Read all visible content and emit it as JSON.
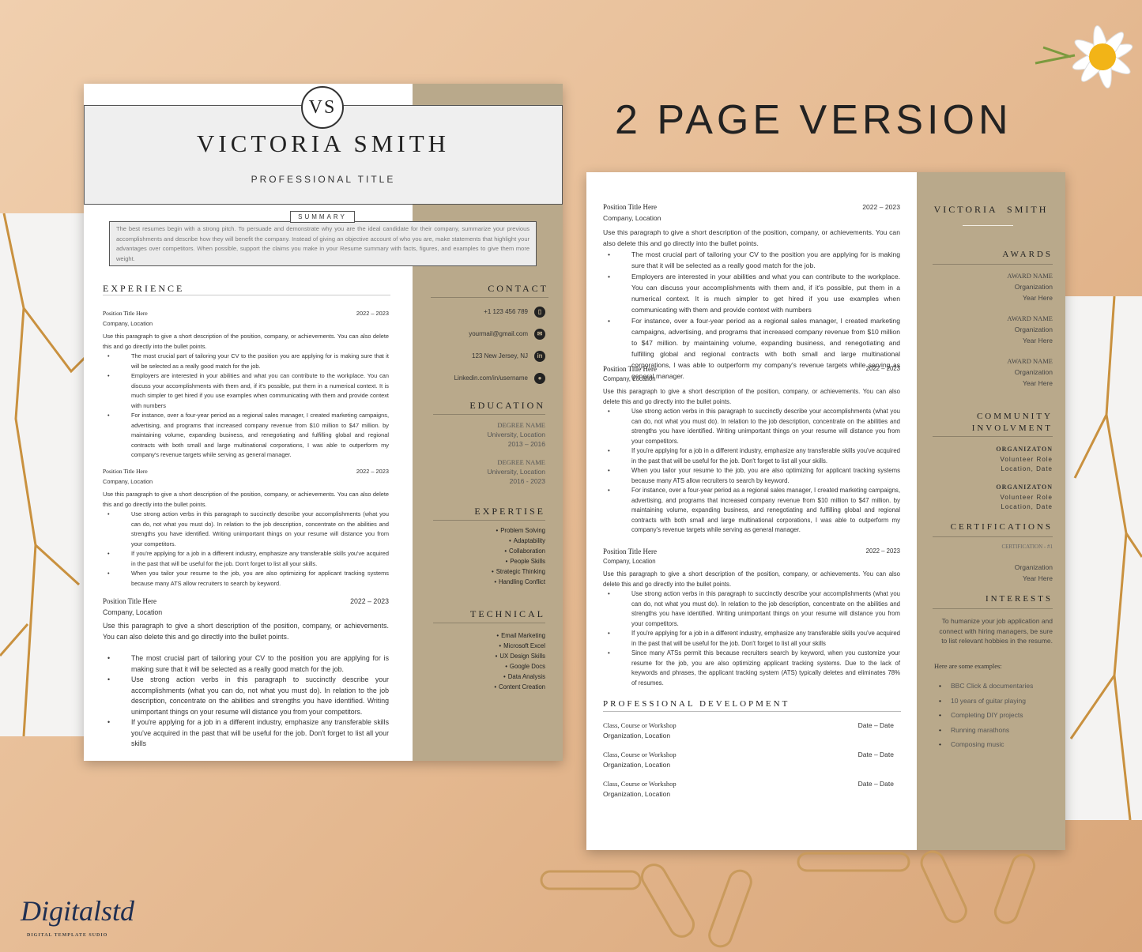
{
  "headline": "2 PAGE VERSION",
  "brand": {
    "logo_text": "Digitalstd",
    "tagline": "DIGITAL TEMPLATE SUDIO"
  },
  "colors": {
    "sidebar": "#b9a98b",
    "background": "#e7bd96",
    "header": "#efefef"
  },
  "page1": {
    "monogram": "VS",
    "name": "VICTORIA SMITH",
    "title": "PROFESSIONAL TITLE",
    "summary_label": "SUMMARY",
    "summary": "The best resumes begin with a strong pitch. To persuade and demonstrate why you are the ideal candidate for their company, summarize your previous accomplishments and describe how they will benefit the company. Instead of giving an objective account of who you are, make statements that highlight your advantages over competitors. When possible, support the claims you make in your Resume summary with facts, figures, and examples to give them more weight.",
    "experience_heading": "EXPERIENCE",
    "jobs": [
      {
        "title": "Position Title Here",
        "date": "2022 – 2023",
        "company": "Company, Location",
        "desc": "Use this paragraph to give a short description of the position, company, or achievements. You can also delete this and go directly into the bullet points.",
        "bullets": [
          "The most crucial part of tailoring your CV to the position you are applying for is making sure that it will be selected as a really good match for the job.",
          "Employers are interested in your abilities and what you can contribute to the workplace. You can discuss your accomplishments with them and, if it's possible, put them in a numerical context. It is much simpler to get hired if you use examples when communicating with them and provide context with numbers",
          "For instance, over a four-year period as a regional sales manager, I created marketing campaigns, advertising, and programs that increased company revenue from $10 million to $47 million. by maintaining volume, expanding business, and renegotiating and fulfilling global and regional contracts with both small and large multinational corporations, I was able to outperform my company's revenue targets while serving as general manager."
        ]
      },
      {
        "title": "Position Title Here",
        "date": "2022 – 2023",
        "company": "Company, Location",
        "desc": "Use this paragraph to give a short description of the position, company, or achievements. You can also delete this and go directly into the bullet points.",
        "bullets": [
          "Use strong action verbs in this paragraph to succinctly describe your accomplishments (what you can do, not what you must do). In relation to the job description, concentrate on the abilities and strengths you have identified. Writing unimportant things on your resume will distance you from your competitors.",
          "If you're applying for a job in a different industry, emphasize any transferable skills you've acquired in the past that will be useful for the job. Don't forget to list all your skills.",
          "When you tailor your resume to the job, you are also optimizing for applicant tracking systems because many ATS allow recruiters to search by keyword."
        ]
      },
      {
        "title": "Position Title Here",
        "date": "2022 – 2023",
        "company": "Company, Location",
        "desc": "Use this paragraph to give a short description of the position, company, or achievements. You can also delete this and go directly into the bullet points.",
        "bullets": [
          "The most crucial part of tailoring your CV to the position you are applying for is making sure that it will be selected as a really good match for the job.",
          "Use strong action verbs in this paragraph to succinctly describe your accomplishments (what you can do, not what you must do). In relation to the job description, concentrate on the abilities and strengths you have identified. Writing unimportant things on your resume will distance you from your competitors.",
          "If you're applying for a job in a different industry, emphasize any transferable skills you've acquired in the past that will be useful for the job. Don't forget to list all your skills"
        ]
      }
    ],
    "contact_heading": "CONTACT",
    "contact": [
      {
        "text": "+1 123 456 789",
        "icon": "phone-icon",
        "glyph": "▯"
      },
      {
        "text": "yourmail@gmail.com",
        "icon": "mail-icon",
        "glyph": "✉"
      },
      {
        "text": "123 New Jersey, NJ",
        "icon": "linkedin-icon",
        "glyph": "in"
      },
      {
        "text": "Linkedin.com/in/username",
        "icon": "location-pin-icon",
        "glyph": "●"
      }
    ],
    "education_heading": "EDUCATION",
    "education": [
      {
        "degree": "DEGREE NAME",
        "school": "University, Location",
        "years": "2013 – 2016"
      },
      {
        "degree": "DEGREE NAME",
        "school": "University, Location",
        "years": "2016 - 2023"
      }
    ],
    "expertise_heading": "EXPERTISE",
    "expertise": [
      "Problem Solving",
      "Adaptability",
      "Collaboration",
      "People Skills",
      "Strategic Thinking",
      "Handling Conflict"
    ],
    "technical_heading": "TECHNICAL",
    "technical": [
      "Email Marketing",
      "Microsoft Excel",
      "UX Design Skills",
      "Google Docs",
      "Data Analysis",
      "Content Creation"
    ]
  },
  "page2": {
    "name": "VICTORIA  SMITH",
    "jobs": [
      {
        "title": "Position Title Here",
        "date": "2022 – 2023",
        "company": "Company, Location",
        "desc": "Use this paragraph to give a short description of the position, company, or achievements. You can also delete this and go directly into the bullet points.",
        "bullets": [
          "The most crucial part of tailoring your CV to the position you are applying for is making sure that it will be selected as a really good match for the job.",
          "Employers are interested in your abilities and what you can contribute to the workplace. You can discuss your accomplishments with them and, if it's possible, put them in a numerical context. It is much simpler to get hired if you use examples when communicating with them and provide context with numbers",
          "For instance, over a four-year period as a regional sales manager, I created marketing campaigns, advertising, and programs that increased company revenue from $10 million to $47 million. by maintaining volume, expanding business, and renegotiating and fulfilling global and regional contracts with both small and large multinational corporations, I was able to outperform my company's revenue targets while serving as general manager."
        ]
      },
      {
        "title": "Position Title Here",
        "date": "2022 – 2023",
        "company": "Company, Location",
        "desc": "Use this paragraph to give a short description of the position, company, or achievements. You can also delete this and go directly into the bullet points.",
        "bullets": [
          "Use strong action verbs in this paragraph to succinctly describe your accomplishments (what you can do, not what you must do). In relation to the job description, concentrate on the abilities and strengths you have identified. Writing unimportant things on your resume will distance you from your competitors.",
          "If you're applying for a job in a different industry, emphasize any transferable skills you've acquired in the past that will be useful for the job. Don't forget to list all your skills.",
          "When you tailor your resume to the job, you are also optimizing for applicant tracking systems because many ATS allow recruiters to search by keyword.",
          "For instance, over a four-year period as a regional sales manager, I created marketing campaigns, advertising, and programs that increased company revenue from $10 million to $47 million. by maintaining volume, expanding business, and renegotiating and fulfilling global and regional contracts with both small and large multinational corporations, I was able to outperform my company's revenue targets while serving as general manager."
        ]
      },
      {
        "title": "Position Title Here",
        "date": "2022 – 2023",
        "company": "Company, Location",
        "desc": "Use this paragraph to give a short description of the position, company, or achievements. You can also delete this and go directly into the bullet points.",
        "bullets": [
          "Use strong action verbs in this paragraph to succinctly describe your accomplishments (what you can do, not what you must do). In relation to the job description, concentrate on the abilities and strengths you have identified. Writing unimportant things on your resume will distance you from your competitors.",
          "If you're applying for a job in a different industry, emphasize any transferable skills you've acquired in the past that will be useful for the job. Don't forget to list all your skills",
          "Since many ATSs permit this because recruiters search by keyword, when you customize your resume for the job, you are also optimizing applicant tracking systems. Due to the lack of keywords and phrases, the applicant tracking system (ATS) typically deletes and eliminates 78% of resumes."
        ]
      }
    ],
    "prof_dev_heading": "PROFESSIONAL DEVELOPMENT",
    "prof_dev": [
      {
        "course": "Class, Course or Workshop",
        "org": "Organization, Location",
        "date": "Date – Date"
      },
      {
        "course": "Class, Course or Workshop",
        "org": "Organization, Location",
        "date": "Date – Date"
      },
      {
        "course": "Class, Course or Workshop",
        "org": "Organization, Location",
        "date": "Date – Date"
      }
    ],
    "awards_heading": "AWARDS",
    "awards": [
      {
        "name": "AWARD NAME",
        "org": "Organization",
        "year": "Year Here"
      },
      {
        "name": "AWARD NAME",
        "org": "Organization",
        "year": "Year Here"
      },
      {
        "name": "AWARD NAME",
        "org": "Organization",
        "year": "Year Here"
      }
    ],
    "community_heading_1": "COMMUNITY",
    "community_heading_2": "INVOLVMENT",
    "community": [
      {
        "org": "ORGANIZATON",
        "role": "Volunteer Role",
        "loc": "Location, Date"
      },
      {
        "org": "ORGANIZATON",
        "role": "Volunteer Role",
        "loc": "Location, Date"
      }
    ],
    "cert_heading": "CERTIFICATIONS",
    "cert": {
      "name": "CERTIFICATION - #1",
      "org": "Organization",
      "year": "Year Here"
    },
    "interests_heading": "INTERESTS",
    "interests_intro": "To humanize your job application and connect with hiring managers, be sure to list relevant hobbies in the resume.",
    "interests_lead": "Here are some examples:",
    "interests": [
      "BBC Click & documentaries",
      "10 years of guitar playing",
      "Completing DIY projects",
      "Running marathons",
      "Composing music"
    ]
  }
}
